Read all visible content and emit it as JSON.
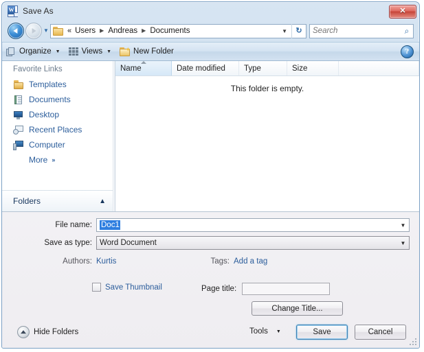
{
  "window": {
    "title": "Save As",
    "title_icon": "word-document-icon",
    "close_label": "✕"
  },
  "address_bar": {
    "back_icon": "back-arrow-icon",
    "forward_icon": "forward-arrow-icon",
    "recent_icon": "chevron-down-icon",
    "folder_icon": "folder-icon",
    "breadcrumb_prefix": "«",
    "breadcrumb": [
      "Users",
      "Andreas",
      "Documents"
    ],
    "separator": "▶",
    "dropdown_icon": "chevron-down-icon",
    "refresh_icon": "refresh-icon",
    "refresh_glyph": "↻",
    "search_placeholder": "Search",
    "search_value": "",
    "search_icon": "search-icon"
  },
  "toolbar": {
    "organize_label": "Organize",
    "views_label": "Views",
    "new_folder_label": "New Folder",
    "caret": "▼",
    "help_label": "?"
  },
  "sidebar": {
    "favorites_header": "Favorite Links",
    "items": [
      {
        "label": "Templates",
        "icon": "folder-icon"
      },
      {
        "label": "Documents",
        "icon": "documents-icon"
      },
      {
        "label": "Desktop",
        "icon": "desktop-monitor-icon"
      },
      {
        "label": "Recent Places",
        "icon": "recent-places-icon"
      },
      {
        "label": "Computer",
        "icon": "computer-icon"
      }
    ],
    "more_label": "More",
    "more_chevron": "»",
    "folders_label": "Folders",
    "folders_chevron": "︿"
  },
  "file_list": {
    "columns": [
      {
        "label": "Name",
        "sorted": true,
        "sort_direction": "ascending"
      },
      {
        "label": "Date modified",
        "sorted": false
      },
      {
        "label": "Type",
        "sorted": false
      },
      {
        "label": "Size",
        "sorted": false
      }
    ],
    "rows": [],
    "empty_message": "This folder is empty."
  },
  "form": {
    "file_name_label": "File name:",
    "file_name_value": "Doc1",
    "file_name_selected": true,
    "save_as_type_label": "Save as type:",
    "save_as_type_value": "Word Document",
    "authors_label": "Authors:",
    "authors_value": "Kurtis",
    "tags_label": "Tags:",
    "tags_value": "Add a tag",
    "save_thumbnail_label": "Save Thumbnail",
    "save_thumbnail_checked": false,
    "page_title_label": "Page title:",
    "page_title_value": "",
    "change_title_label": "Change Title..."
  },
  "footer": {
    "hide_folders_label": "Hide Folders",
    "hide_folders_icon": "collapse-up-icon",
    "tools_label": "Tools",
    "tools_caret": "▼",
    "save_label": "Save",
    "cancel_label": "Cancel"
  },
  "colors": {
    "frame": "#cfe0ef",
    "accent_link": "#2b5d9b",
    "selection": "#2f7fe0",
    "default_button_border": "#3c7fb1"
  }
}
